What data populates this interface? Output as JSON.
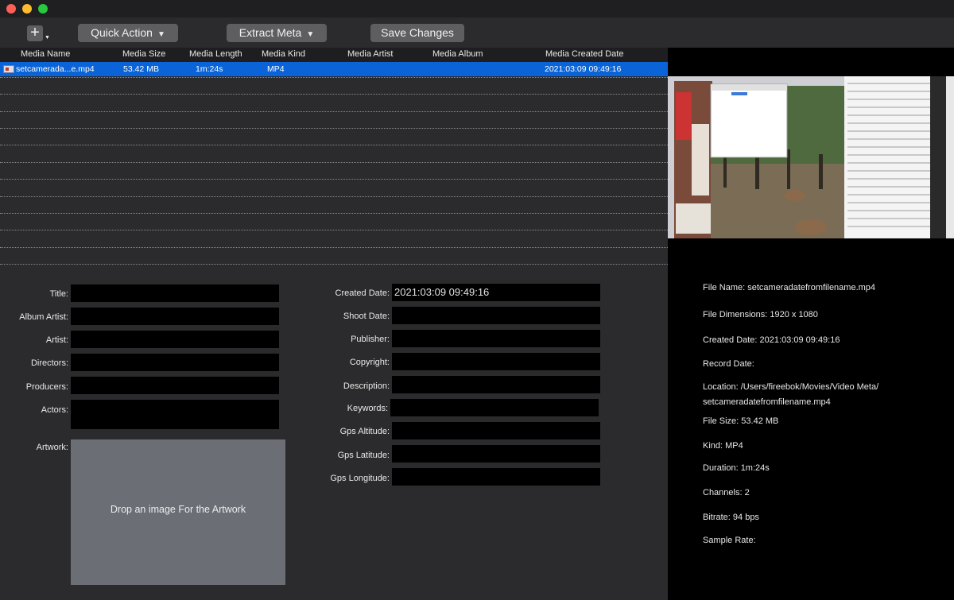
{
  "toolbar": {
    "add_label": "+",
    "quick_action_label": "Quick Action",
    "extract_meta_label": "Extract Meta",
    "save_changes_label": "Save Changes"
  },
  "table": {
    "columns": [
      "Media Name",
      "Media Size",
      "Media Length",
      "Media Kind",
      "Media Artist",
      "Media Album",
      "Media Created Date"
    ],
    "rows": [
      {
        "name": "setcamerada...e.mp4",
        "size": "53.42 MB",
        "length": "1m:24s",
        "kind": "MP4",
        "artist": "",
        "album": "",
        "created": "2021:03:09 09:49:16"
      }
    ]
  },
  "form": {
    "left": {
      "title_label": "Title:",
      "album_artist_label": "Album Artist:",
      "artist_label": "Artist:",
      "directors_label": "Directors:",
      "producers_label": "Producers:",
      "actors_label": "Actors:",
      "artwork_label": "Artwork:",
      "artwork_drop_text": "Drop an image For the Artwork"
    },
    "right": {
      "created_date_label": "Created Date:",
      "created_date_value": "2021:03:09 09:49:16",
      "shoot_date_label": "Shoot Date:",
      "publisher_label": "Publisher:",
      "copyright_label": "Copyright:",
      "description_label": "Description:",
      "keywords_label": "Keywords:",
      "gps_altitude_label": "Gps Altitude:",
      "gps_latitude_label": "Gps Latitude:",
      "gps_longitude_label": "Gps Longitude:"
    }
  },
  "info": {
    "file_name": "File Name: setcameradatefromfilename.mp4",
    "file_dimensions": "File Dimensions: 1920 x 1080",
    "created_date": "Created Date: 2021:03:09 09:49:16",
    "record_date": "Record Date:",
    "location_line1": "Location: /Users/fireebok/Movies/Video Meta/",
    "location_line2": "setcameradatefromfilename.mp4",
    "file_size": "File Size: 53.42 MB",
    "kind": "Kind: MP4",
    "duration": "Duration: 1m:24s",
    "channels": "Channels: 2",
    "bitrate": "Bitrate: 94 bps",
    "sample_rate": "Sample Rate:"
  }
}
